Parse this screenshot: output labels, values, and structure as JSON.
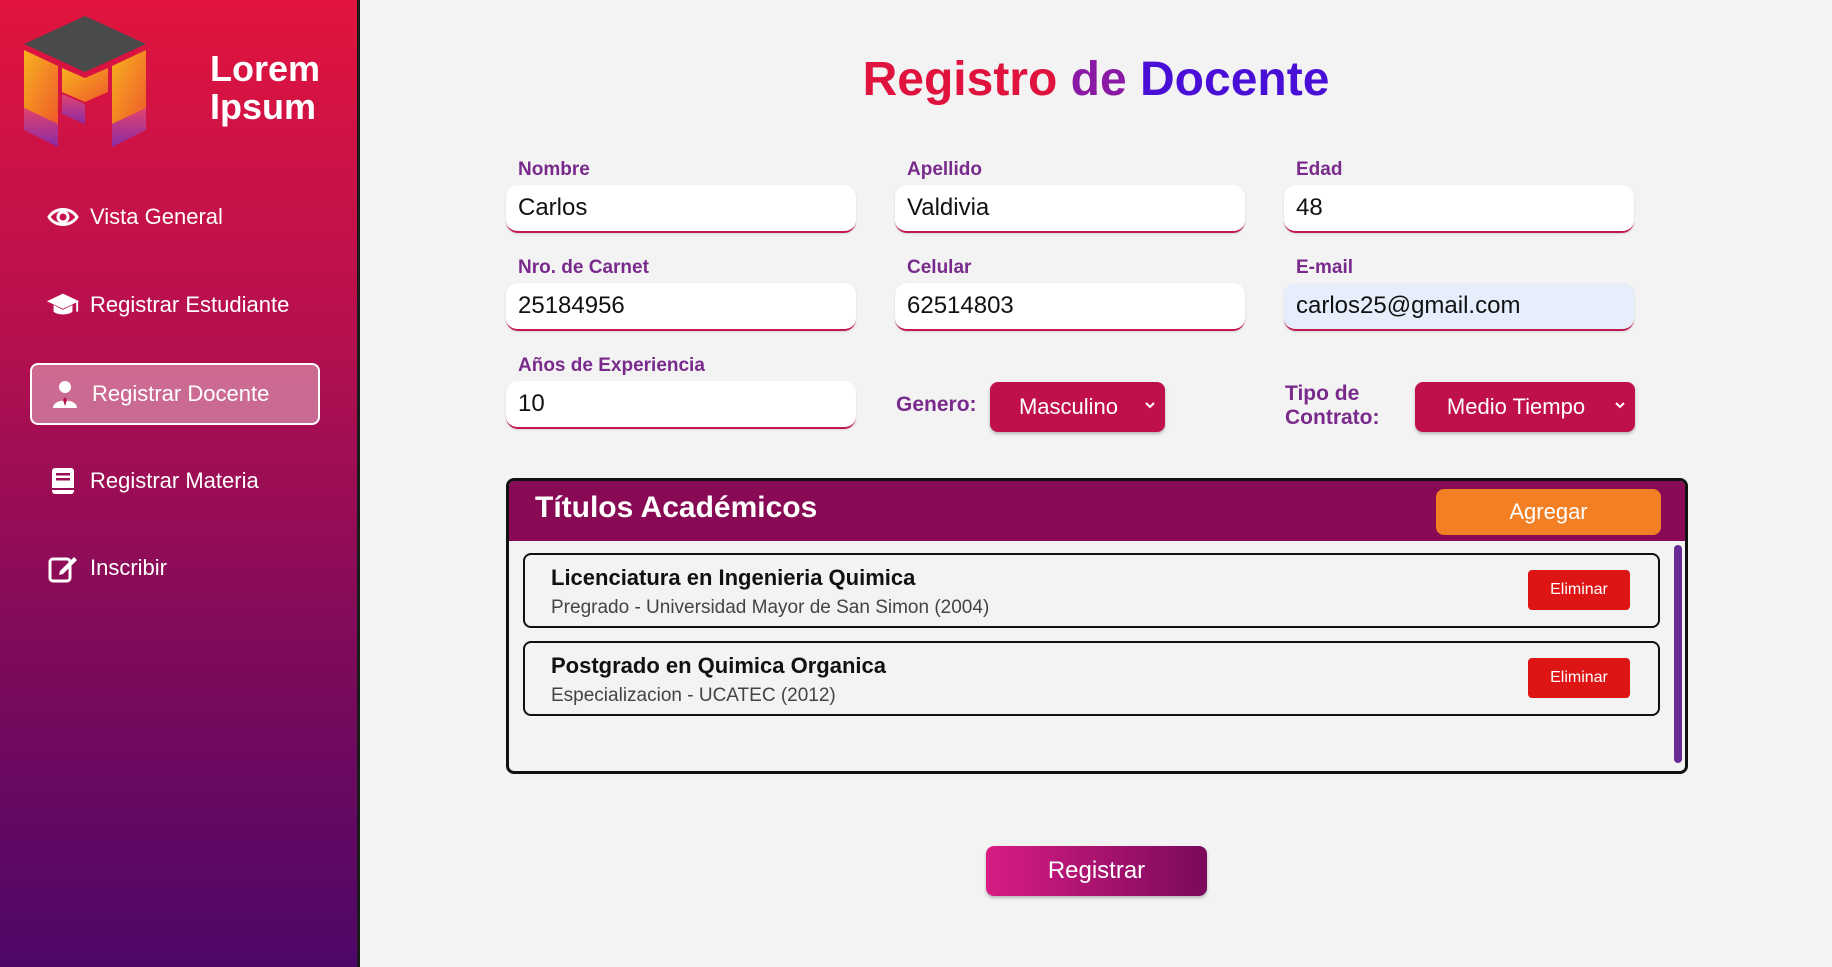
{
  "brand": {
    "line1": "Lorem",
    "line2": "Ipsum"
  },
  "sidebar": {
    "items": [
      {
        "label": "Vista General",
        "icon": "eye-icon"
      },
      {
        "label": "Registrar Estudiante",
        "icon": "graduation-cap-icon"
      },
      {
        "label": "Registrar Docente",
        "icon": "user-tie-icon",
        "active": true
      },
      {
        "label": "Registrar Materia",
        "icon": "book-icon"
      },
      {
        "label": "Inscribir",
        "icon": "edit-icon"
      }
    ]
  },
  "page_title": {
    "part1": "Registro",
    "part2": "de",
    "part3": "Docente"
  },
  "form": {
    "nombre": {
      "label": "Nombre",
      "value": "Carlos"
    },
    "apellido": {
      "label": "Apellido",
      "value": "Valdivia"
    },
    "edad": {
      "label": "Edad",
      "value": "48"
    },
    "carnet": {
      "label": "Nro. de Carnet",
      "value": "25184956"
    },
    "celular": {
      "label": "Celular",
      "value": "62514803"
    },
    "email": {
      "label": "E-mail",
      "value": "carlos25@gmail.com"
    },
    "experiencia": {
      "label": "Años de Experiencia",
      "value": "10"
    },
    "genero": {
      "label": "Genero:",
      "value": "Masculino"
    },
    "contrato": {
      "label_line1": "Tipo de",
      "label_line2": "Contrato:",
      "value": "Medio Tiempo"
    }
  },
  "titulos": {
    "header": "Títulos Académicos",
    "add_label": "Agregar",
    "items": [
      {
        "title": "Licenciatura en Ingenieria Quimica",
        "subtitle": "Pregrado - Universidad Mayor de San Simon (2004)",
        "delete_label": "Eliminar"
      },
      {
        "title": "Postgrado en Quimica Organica",
        "subtitle": "Especializacion - UCATEC (2012)",
        "delete_label": "Eliminar"
      }
    ]
  },
  "submit_label": "Registrar",
  "colors": {
    "accent": "#c0104a",
    "header": "#880a55",
    "add": "#f27f23",
    "delete": "#dd1515",
    "label": "#7a2a8c"
  }
}
